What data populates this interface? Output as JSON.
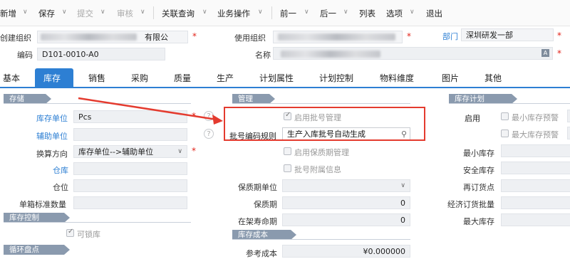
{
  "toolbar": {
    "items": [
      "新增",
      "保存",
      "提交",
      "审核",
      "关联查询",
      "业务操作",
      "前一",
      "后一",
      "列表",
      "选项",
      "退出"
    ]
  },
  "header": {
    "create_org_label": "创建组织",
    "create_org_value": "有限公",
    "use_org_label": "使用组织",
    "dept_label": "部门",
    "dept_value": "深圳研发一部",
    "code_label": "编码",
    "code_value": "D101-0010-A0",
    "name_label": "名称"
  },
  "tabs": [
    "基本",
    "库存",
    "销售",
    "采购",
    "质量",
    "生产",
    "计划属性",
    "计划控制",
    "物料维度",
    "图片",
    "其他"
  ],
  "storage": {
    "title": "存储",
    "unit_label": "库存单位",
    "unit_value": "Pcs",
    "aux_unit_label": "辅助单位",
    "conv_label": "换算方向",
    "conv_value": "库存单位-->辅助单位",
    "warehouse_label": "仓库",
    "location_label": "仓位",
    "box_label": "单箱标准数量"
  },
  "stock_control": {
    "title": "库存控制",
    "lockable_label": "可锁库"
  },
  "cycle_count": {
    "title": "循环盘点"
  },
  "management": {
    "title": "管理",
    "batch_mgmt_label": "启用批号管理",
    "batch_rule_label": "批号编码规则",
    "batch_rule_value": "生产入库批号自动生成",
    "shelf_mgmt_label": "启用保质期管理",
    "batch_attach_label": "批号附属信息",
    "shelf_unit_label": "保质期单位",
    "shelf_label": "保质期",
    "shelf_value": "0",
    "shelf_life_label": "在架寿命期",
    "shelf_life_value": "0"
  },
  "stock_cost": {
    "title": "库存成本",
    "ref_cost_label": "参考成本",
    "ref_cost_value": "¥0.000000"
  },
  "stock_plan": {
    "title": "库存计划",
    "enable_label": "启用",
    "min_warn_label": "最小库存预警",
    "max_warn_label": "最大库存预警",
    "min_stock_label": "最小库存",
    "safety_stock_label": "安全库存",
    "reorder_label": "再订货点",
    "econ_batch_label": "经济订货批量",
    "max_stock_label": "最大库存"
  },
  "colors": {
    "accent": "#2d7fd3",
    "section": "#8a9aae",
    "highlight": "#e43b2f"
  }
}
